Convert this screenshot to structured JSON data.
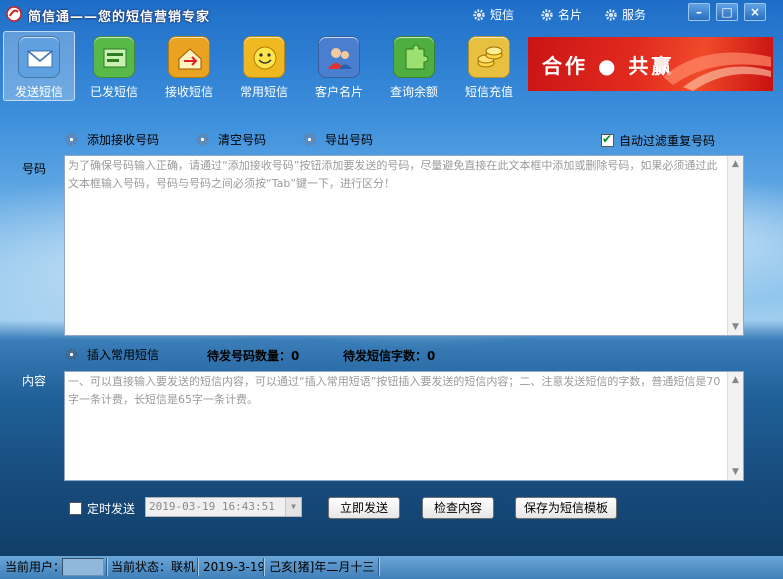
{
  "titlebar": {
    "title": "简信通——您的短信营销专家",
    "links": [
      {
        "label": "短信",
        "icon": "gear-icon"
      },
      {
        "label": "名片",
        "icon": "gear-icon"
      },
      {
        "label": "服务",
        "icon": "gear-icon"
      }
    ],
    "buttons": {
      "minimize": "–",
      "maximize": "□",
      "close": "×"
    }
  },
  "toolbar": {
    "items": [
      {
        "label": "发送短信",
        "icon": "envelope-icon",
        "color": "#5ea0e0"
      },
      {
        "label": "已发短信",
        "icon": "sent-box-icon",
        "color": "#58b848"
      },
      {
        "label": "接收短信",
        "icon": "inbox-arrow-icon",
        "color": "#e9a320"
      },
      {
        "label": "常用短信",
        "icon": "smiley-icon",
        "color": "#f0b820"
      },
      {
        "label": "客户名片",
        "icon": "contacts-icon",
        "color": "#4a7fd0"
      },
      {
        "label": "查询余额",
        "icon": "puzzle-icon",
        "color": "#4fae40"
      },
      {
        "label": "短信充值",
        "icon": "coins-icon",
        "color": "#e8c040"
      }
    ]
  },
  "banner": {
    "text": "合作 ● 共赢"
  },
  "options": {
    "add_number": "添加接收号码",
    "clear_number": "清空号码",
    "export_number": "导出号码",
    "auto_filter": "自动过滤重复号码",
    "auto_filter_checked": true
  },
  "number": {
    "label": "号码",
    "placeholder": "为了确保号码输入正确，请通过“添加接收号码”按钮添加要发送的号码，尽量避免直接在此文本框中添加或删除号码，如果必须通过此文本框输入号码，号码与号码之间必须按“Tab”键一下，进行区分！"
  },
  "middle": {
    "insert_common": "插入常用短信",
    "pending_numbers": "待发号码数量：0",
    "pending_chars": "待发短信字数：0"
  },
  "content": {
    "label": "内容",
    "placeholder": "一、可以直接输入要发送的短信内容，可以通过“插入常用短语”按钮插入要发送的短信内容；二、注意发送短信的字数，普通短信是70字一条计费，长短信是65字一条计费。"
  },
  "bottom": {
    "scheduled_label": "定时发送",
    "scheduled_checked": false,
    "datetime": "2019-03-19  16:43:51",
    "send_now": "立即发送",
    "check_content": "检查内容",
    "save_template": "保存为短信模板"
  },
  "status": {
    "user_label": "当前用户：",
    "user_value": "",
    "state_label": "当前状态：联机",
    "date": "2019-3-19",
    "lunar": "己亥[猪]年二月十三"
  }
}
